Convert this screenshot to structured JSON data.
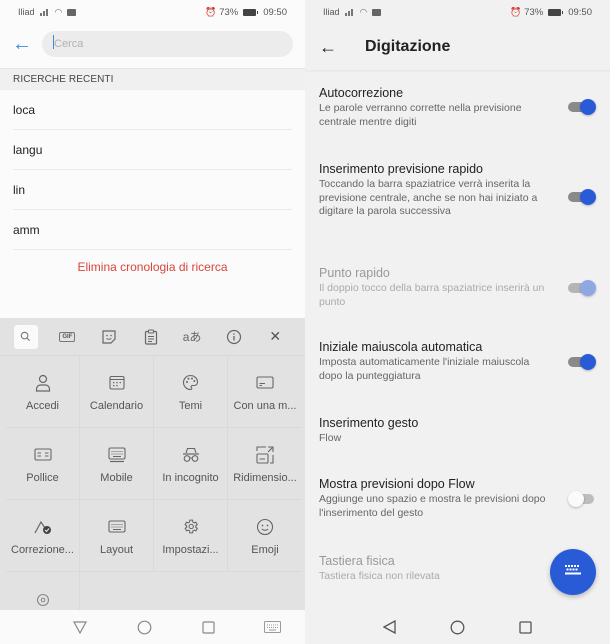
{
  "status_bar": {
    "carrier": "Iliad",
    "battery_percent": "73%",
    "time": "09:50"
  },
  "search_screen": {
    "search": {
      "placeholder": "Cerca",
      "value": ""
    },
    "recent_header": "RICERCHE RECENTI",
    "recent_searches": [
      "loca",
      "langu",
      "lin",
      "amm"
    ],
    "clear_history_label": "Elimina cronologia di ricerca",
    "toolbar_icons": [
      "search-icon",
      "gif-icon",
      "sticker-icon",
      "clipboard-icon",
      "translate-icon",
      "info-icon",
      "close-icon"
    ],
    "gif_label": "GIF",
    "keyboard_tiles": [
      {
        "label": "Accedi",
        "icon": "account-icon"
      },
      {
        "label": "Calendario",
        "icon": "calendar-icon"
      },
      {
        "label": "Temi",
        "icon": "palette-icon"
      },
      {
        "label": "Con una m...",
        "icon": "one-hand-icon"
      },
      {
        "label": "Pollice",
        "icon": "thumb-layout-icon"
      },
      {
        "label": "Mobile",
        "icon": "floating-keyboard-icon"
      },
      {
        "label": "In incognito",
        "icon": "incognito-icon"
      },
      {
        "label": "Ridimensio...",
        "icon": "resize-icon"
      },
      {
        "label": "Correzione...",
        "icon": "autocorrect-icon"
      },
      {
        "label": "Layout",
        "icon": "keyboard-layout-icon"
      },
      {
        "label": "Impostazi...",
        "icon": "settings-icon"
      },
      {
        "label": "Emoji",
        "icon": "emoji-icon"
      },
      {
        "label": "",
        "icon": "location-icon"
      }
    ]
  },
  "settings_screen": {
    "title": "Digitazione",
    "settings": [
      {
        "title": "Autocorrezione",
        "description": "Le parole verranno corrette nella previsione centrale mentre digiti",
        "toggle": true,
        "enabled": true
      },
      {
        "title": "Inserimento previsione rapido",
        "description": "Toccando la barra spaziatrice verrà inserita la previsione centrale, anche se non hai iniziato a digitare la parola successiva",
        "toggle": true,
        "enabled": true
      },
      {
        "title": "Punto rapido",
        "description": "Il doppio tocco della barra spaziatrice inserirà un punto",
        "toggle": true,
        "enabled": false
      },
      {
        "title": "Iniziale maiuscola automatica",
        "description": "Imposta automaticamente l'iniziale maiuscola dopo la punteggiatura",
        "toggle": true,
        "enabled": true
      },
      {
        "title": "Inserimento gesto",
        "description": "Flow"
      },
      {
        "title": "Mostra previsioni dopo Flow",
        "description": "Aggiunge uno spazio e mostra le previsioni dopo l'inserimento del gesto",
        "toggle": false,
        "enabled": true
      },
      {
        "title": "Tastiera fisica",
        "description": "Tastiera fisica non rilevata",
        "enabled": false
      }
    ]
  },
  "colors": {
    "accent_blue": "#2a5bd7",
    "link_blue": "#3a8be0",
    "destructive_red": "#d9453a"
  }
}
